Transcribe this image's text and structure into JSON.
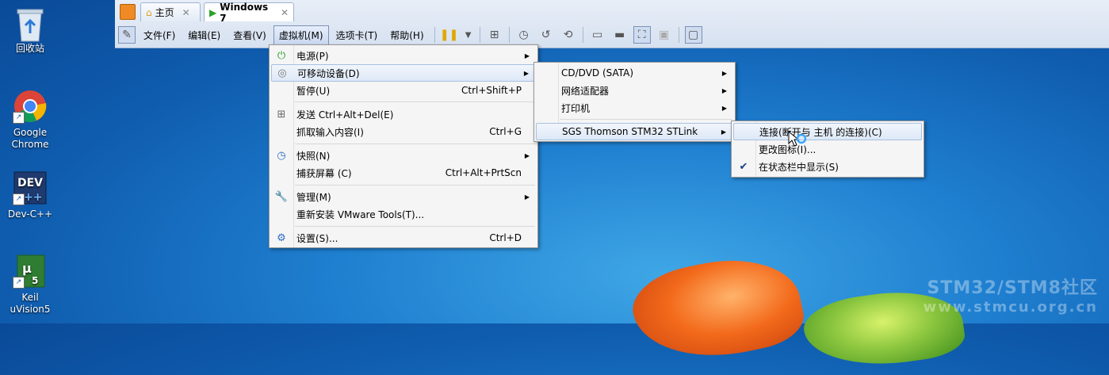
{
  "desktop": {
    "icons": [
      {
        "label1": "回收站",
        "label2": ""
      },
      {
        "label1": "Google",
        "label2": "Chrome"
      },
      {
        "label1": "Dev-C++",
        "label2": ""
      },
      {
        "label1": "Keil",
        "label2": "uVision5"
      }
    ],
    "watermark": {
      "line1": "STM32/STM8社区",
      "line2": "www.stmcu.org.cn"
    }
  },
  "tabs": [
    {
      "label": "主页"
    },
    {
      "label": "Windows 7"
    }
  ],
  "menubar": [
    {
      "label": "文件(F)"
    },
    {
      "label": "编辑(E)"
    },
    {
      "label": "查看(V)"
    },
    {
      "label": "虚拟机(M)"
    },
    {
      "label": "选项卡(T)"
    },
    {
      "label": "帮助(H)"
    }
  ],
  "vm_menu": [
    {
      "label": "电源(P)",
      "shortcut": ""
    },
    {
      "label": "可移动设备(D)",
      "shortcut": ""
    },
    {
      "label": "暂停(U)",
      "shortcut": "Ctrl+Shift+P"
    },
    {
      "label": "发送 Ctrl+Alt+Del(E)",
      "shortcut": ""
    },
    {
      "label": "抓取输入内容(I)",
      "shortcut": "Ctrl+G"
    },
    {
      "label": "快照(N)",
      "shortcut": ""
    },
    {
      "label": "捕获屏幕 (C)",
      "shortcut": "Ctrl+Alt+PrtScn"
    },
    {
      "label": "管理(M)",
      "shortcut": ""
    },
    {
      "label": "重新安装 VMware Tools(T)...",
      "shortcut": ""
    },
    {
      "label": "设置(S)...",
      "shortcut": "Ctrl+D"
    }
  ],
  "removable_menu": [
    {
      "label": "CD/DVD (SATA)"
    },
    {
      "label": "网络适配器"
    },
    {
      "label": "打印机"
    },
    {
      "label": "SGS Thomson STM32 STLink"
    }
  ],
  "stlink_menu": [
    {
      "label": "连接(断开与 主机 的连接)(C)"
    },
    {
      "label": "更改图标(I)..."
    },
    {
      "label": "在状态栏中显示(S)"
    }
  ]
}
